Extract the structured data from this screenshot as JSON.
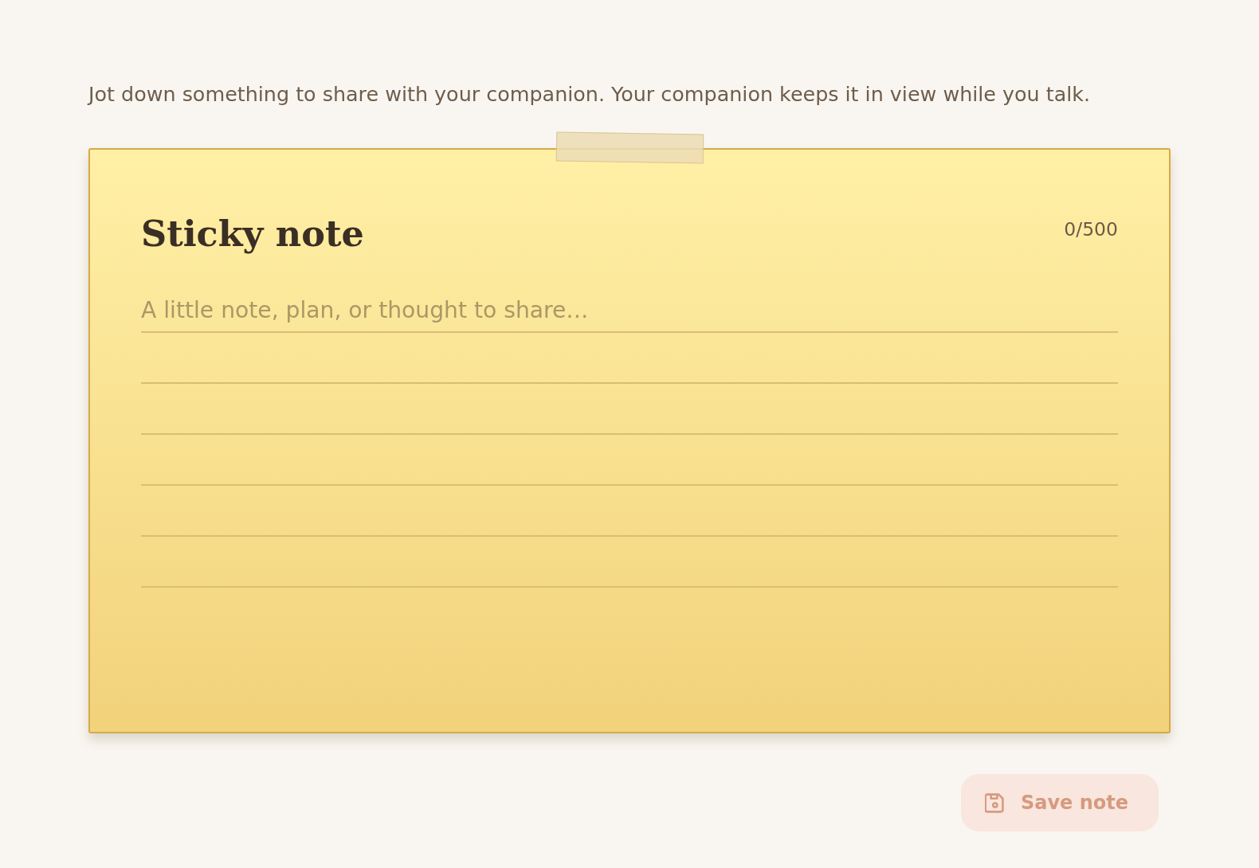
{
  "intro": "Jot down something to share with your companion. Your companion keeps it in view while you talk.",
  "note": {
    "title": "Sticky note",
    "counter": "0/500",
    "placeholder": "A little note, plan, or thought to share…"
  },
  "save_button": {
    "label": "Save note",
    "disabled": true
  }
}
